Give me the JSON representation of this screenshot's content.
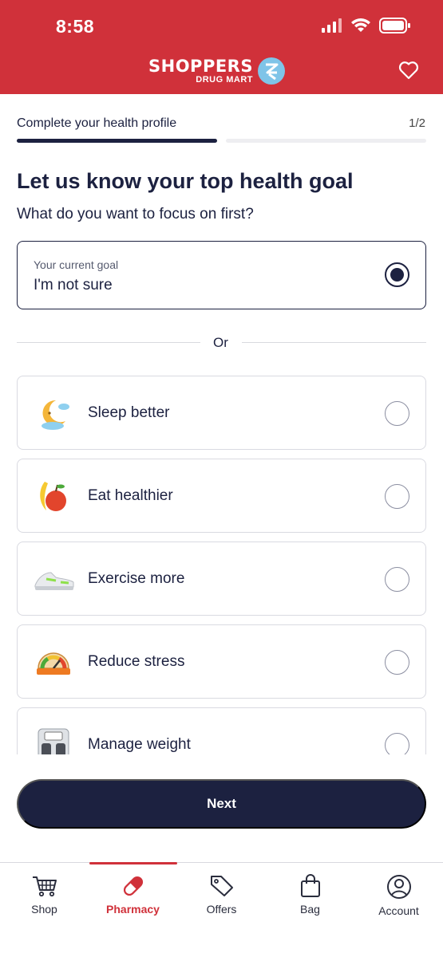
{
  "status_bar": {
    "time": "8:58"
  },
  "header": {
    "brand_main": "SHOPPERS",
    "brand_sub": "DRUG MART"
  },
  "progress": {
    "title": "Complete your health profile",
    "count": "1/2",
    "fraction": 0.5
  },
  "heading": "Let us know your top health goal",
  "subheading": "What do you want to focus on first?",
  "current_goal": {
    "label": "Your current goal",
    "value": "I'm not sure",
    "selected": true
  },
  "divider_text": "Or",
  "options": [
    {
      "label": "Sleep better",
      "icon": "moon-sleep-icon"
    },
    {
      "label": "Eat healthier",
      "icon": "fruit-icon"
    },
    {
      "label": "Exercise more",
      "icon": "sneaker-icon"
    },
    {
      "label": "Reduce stress",
      "icon": "stress-meter-icon"
    },
    {
      "label": "Manage weight",
      "icon": "scale-icon"
    }
  ],
  "next_button": "Next",
  "bottom_nav": [
    {
      "label": "Shop",
      "icon": "cart-icon",
      "active": false
    },
    {
      "label": "Pharmacy",
      "icon": "pill-icon",
      "active": true
    },
    {
      "label": "Offers",
      "icon": "tag-icon",
      "active": false
    },
    {
      "label": "Bag",
      "icon": "bag-icon",
      "active": false
    },
    {
      "label": "Account",
      "icon": "user-icon",
      "active": false
    }
  ],
  "colors": {
    "brand_red": "#d0313a",
    "navy": "#1c2140"
  }
}
